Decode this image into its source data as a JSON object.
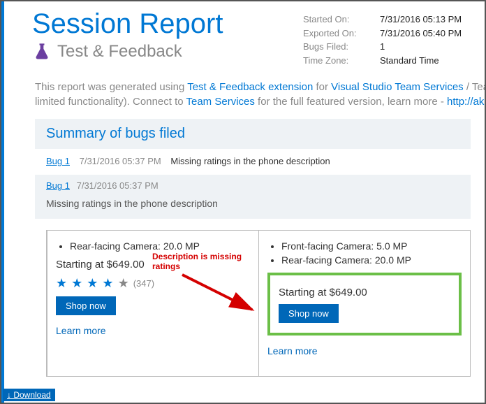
{
  "header": {
    "title": "Session Report",
    "subtitle": "Test & Feedback"
  },
  "meta": {
    "started_label": "Started On:",
    "started_value": "7/31/2016 05:13 PM",
    "exported_label": "Exported On:",
    "exported_value": "7/31/2016 05:40 PM",
    "bugs_label": "Bugs Filed:",
    "bugs_value": "1",
    "tz_label": "Time Zone:",
    "tz_value": "Standard Time"
  },
  "intro": {
    "t1": "This report was generated using ",
    "link1": "Test & Feedback extension",
    "t2": " for ",
    "link2": "Visual Studio Team Services",
    "t3": " / Team",
    "line2a": "limited functionality). Connect to ",
    "link3": "Team Services",
    "line2b": " for the full featured version, learn more - ",
    "link4": "http://ak"
  },
  "section": {
    "title": "Summary of bugs filed"
  },
  "bug_summary": {
    "link": "Bug 1",
    "date": "7/31/2016 05:37 PM",
    "title": "Missing ratings in the phone description"
  },
  "bug_detail": {
    "link": "Bug 1",
    "date": "7/31/2016 05:37 PM",
    "desc": "Missing ratings in the phone description"
  },
  "screenshot": {
    "left": {
      "bullet1": "Rear-facing Camera: 20.0 MP",
      "price": "Starting at $649.00",
      "rating_count": "(347)",
      "shop": "Shop now",
      "learn": "Learn more",
      "annotation": "Description is missing ratings"
    },
    "right": {
      "bullet1": "Front-facing Camera: 5.0 MP",
      "bullet2": "Rear-facing Camera: 20.0 MP",
      "price": "Starting at $649.00",
      "shop": "Shop now",
      "learn": "Learn more"
    }
  },
  "download": {
    "label": "↓ Download"
  }
}
